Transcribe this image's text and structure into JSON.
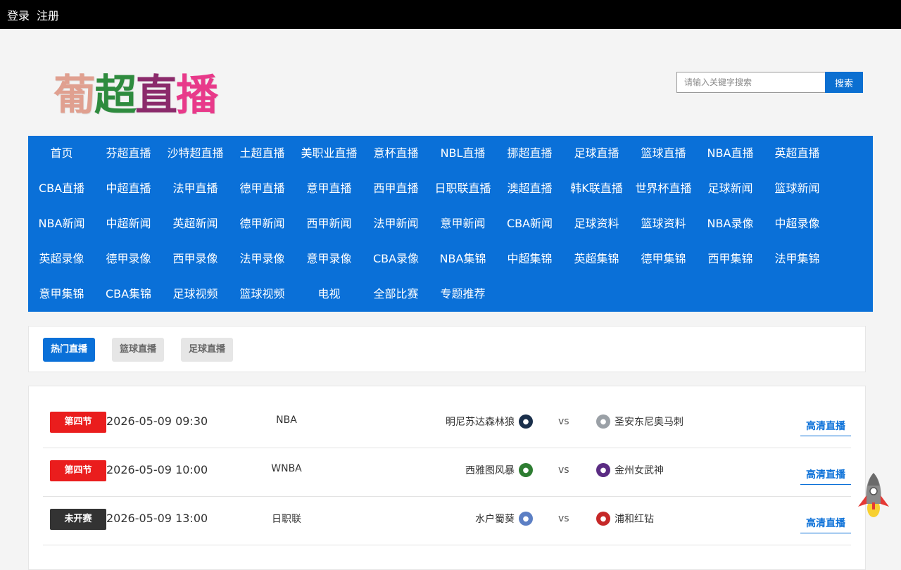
{
  "topbar": {
    "login": "登录",
    "register": "注册"
  },
  "logo": {
    "chars": [
      "葡",
      "超",
      "直",
      "播"
    ],
    "colors": [
      "#e0a090",
      "#2e8b3e",
      "#8b2a6b",
      "#e83a8a"
    ]
  },
  "search": {
    "placeholder": "请输入关键字搜索",
    "button": "搜索"
  },
  "nav": {
    "items": [
      "首页",
      "芬超直播",
      "沙特超直播",
      "土超直播",
      "美职业直播",
      "意杯直播",
      "NBL直播",
      "挪超直播",
      "足球直播",
      "篮球直播",
      "NBA直播",
      "英超直播",
      "CBA直播",
      "中超直播",
      "法甲直播",
      "德甲直播",
      "意甲直播",
      "西甲直播",
      "日职联直播",
      "澳超直播",
      "韩K联直播",
      "世界杯直播",
      "足球新闻",
      "篮球新闻",
      "NBA新闻",
      "中超新闻",
      "英超新闻",
      "德甲新闻",
      "西甲新闻",
      "法甲新闻",
      "意甲新闻",
      "CBA新闻",
      "足球资料",
      "篮球资料",
      "NBA录像",
      "中超录像",
      "英超录像",
      "德甲录像",
      "西甲录像",
      "法甲录像",
      "意甲录像",
      "CBA录像",
      "NBA集锦",
      "中超集锦",
      "英超集锦",
      "德甲集锦",
      "西甲集锦",
      "法甲集锦",
      "意甲集锦",
      "CBA集锦",
      "足球视频",
      "篮球视频",
      "电视",
      "全部比赛",
      "专题推荐"
    ]
  },
  "tabs": [
    "热门直播",
    "篮球直播",
    "足球直播"
  ],
  "matches": [
    {
      "status": "第四节",
      "status_type": "live",
      "time": "2026-05-09 09:30",
      "league": "NBA",
      "home": "明尼苏达森林狼",
      "home_icon": "wolf-logo-icon",
      "home_color": "#1a2f4b",
      "vs": "vs",
      "away": "圣安东尼奥马刺",
      "away_icon": "spurs-logo-icon",
      "away_color": "#9aa0a6",
      "watch": "高清直播"
    },
    {
      "status": "第四节",
      "status_type": "live",
      "time": "2026-05-09 10:00",
      "league": "WNBA",
      "home": "西雅图风暴",
      "home_icon": "storm-logo-icon",
      "home_color": "#2e7d32",
      "vs": "vs",
      "away": "金州女武神",
      "away_icon": "valkyries-logo-icon",
      "away_color": "#5b2c83",
      "watch": "高清直播"
    },
    {
      "status": "未开赛",
      "status_type": "wait",
      "time": "2026-05-09 13:00",
      "league": "日职联",
      "home": "水户蜀葵",
      "home_icon": "hollyhock-logo-icon",
      "home_color": "#5c7fc4",
      "vs": "vs",
      "away": "浦和红钻",
      "away_icon": "reds-logo-icon",
      "away_color": "#c62828",
      "watch": "高清直播"
    }
  ]
}
